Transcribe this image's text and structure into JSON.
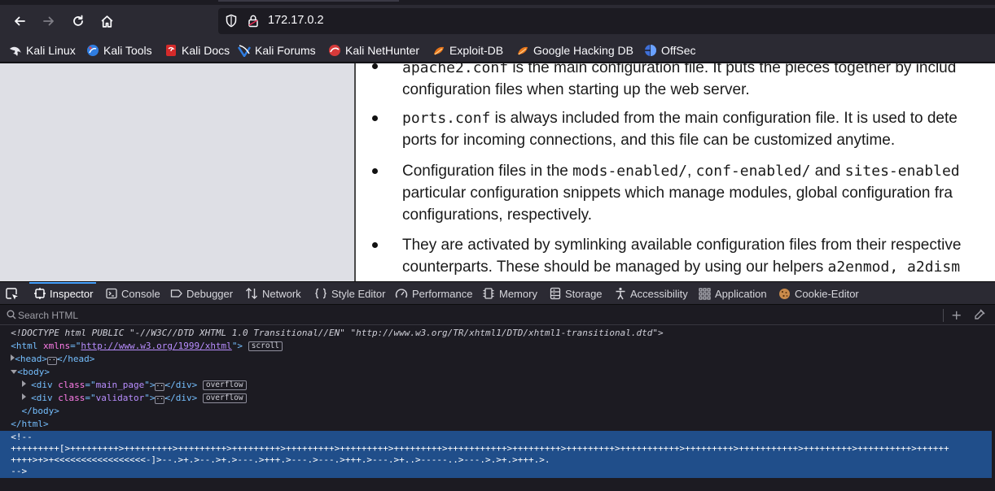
{
  "browser": {
    "url": "172.17.0.2",
    "bookmarks": [
      {
        "label": "Kali Linux",
        "icon": "kali-dragon-icon"
      },
      {
        "label": "Kali Tools",
        "icon": "kali-tools-icon"
      },
      {
        "label": "Kali Docs",
        "icon": "kali-docs-icon"
      },
      {
        "label": "Kali Forums",
        "icon": "kali-forums-icon"
      },
      {
        "label": "Kali NetHunter",
        "icon": "kali-nethunter-icon"
      },
      {
        "label": "Exploit-DB",
        "icon": "exploit-db-icon"
      },
      {
        "label": "Google Hacking DB",
        "icon": "ghdb-icon"
      },
      {
        "label": "OffSec",
        "icon": "offsec-icon"
      }
    ]
  },
  "page": {
    "items": [
      {
        "l1_code": "apache2.conf",
        "l1_text": " is the main configuration file. It puts the pieces together by includ",
        "l2": "configuration files when starting up the web server."
      },
      {
        "l1_code": "ports.conf",
        "l1_text": " is always included from the main configuration file. It is used to dete",
        "l2": "ports for incoming connections, and this file can be customized anytime."
      },
      {
        "l1_pre": "Configuration files in the ",
        "code1": "mods-enabled/",
        "sep1": ", ",
        "code2": "conf-enabled/",
        "sep2": " and ",
        "code3": "sites-enabled",
        "l2": "particular configuration snippets which manage modules, global configuration fra",
        "l3": "configurations, respectively."
      },
      {
        "l1": "They are activated by symlinking available configuration files from their respective",
        "l2_pre": "counterparts. These should be managed by using our helpers ",
        "l2_code": "a2enmod, a2dism"
      }
    ]
  },
  "devtools": {
    "tabs": [
      {
        "label": "Inspector",
        "icon": "inspector-icon",
        "active": true
      },
      {
        "label": "Console",
        "icon": "console-icon"
      },
      {
        "label": "Debugger",
        "icon": "debugger-icon"
      },
      {
        "label": "Network",
        "icon": "network-icon"
      },
      {
        "label": "Style Editor",
        "icon": "style-editor-icon"
      },
      {
        "label": "Performance",
        "icon": "performance-icon"
      },
      {
        "label": "Memory",
        "icon": "memory-icon"
      },
      {
        "label": "Storage",
        "icon": "storage-icon"
      },
      {
        "label": "Accessibility",
        "icon": "accessibility-icon"
      },
      {
        "label": "Application",
        "icon": "application-icon"
      },
      {
        "label": "Cookie-Editor",
        "icon": "cookie-icon"
      }
    ],
    "search_placeholder": "Search HTML",
    "markup": {
      "doctype": "<!DOCTYPE html PUBLIC \"-//W3C//DTD XHTML 1.0 Transitional//EN\" \"http://www.w3.org/TR/xhtml1/DTD/xhtml1-transitional.dtd\">",
      "html_open_tag": "<html",
      "html_attr": "xmlns",
      "html_xmlns": "http://www.w3.org/1999/xhtml",
      "html_badge": "scroll",
      "head_open": "<head>",
      "head_close": "</head>",
      "body_open": "<body>",
      "div1_class": "main_page",
      "div2_class": "validator",
      "div_open": "<div",
      "div_attr": "class",
      "div_close": "</div>",
      "overflow_badge": "overflow",
      "body_close": "</body>",
      "html_close": "</html>",
      "comment_open": "<!--",
      "comment_line1": "+++++++++[>+++++++++>+++++++++>+++++++++>+++++++++>+++++++++>+++++++++>+++++++++>+++++++++++>+++++++++>+++++++++>+++++++++++>+++++++++>+++++++++++>+++++++++>++++++++++>++++++",
      "comment_line2": "++++>+>+<<<<<<<<<<<<<<<<<-]>--.>+.>--.>+.>---.>+++.>---.>---.>+++.>---.>+..>-----..>---.>.>+.>+++.>.",
      "comment_close": "-->"
    }
  }
}
